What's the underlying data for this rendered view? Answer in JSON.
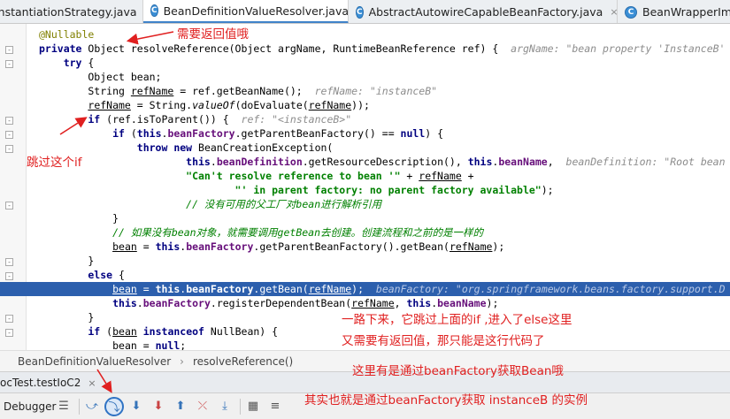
{
  "tabs": [
    {
      "label": "InstantiationStrategy.java",
      "active": false
    },
    {
      "label": "BeanDefinitionValueResolver.java",
      "active": true
    },
    {
      "label": "AbstractAutowireCapableBeanFactory.java",
      "active": false
    },
    {
      "label": "BeanWrapperImp",
      "active": false
    }
  ],
  "tab_close_glyph": "×",
  "code": {
    "l1": "@Nullable",
    "l2_a": "private ",
    "l2_b": "Object resolveReference(Object argName, RuntimeBeanReference ref) {",
    "l2_hint": "argName: \"bean property 'InstanceB'",
    "l3_a": "    try",
    "l3_b": " {",
    "l4": "        Object bean;",
    "l5_a": "        String ",
    "l5_b": "refName",
    "l5_c": " = ref.getBeanName();",
    "l5_hint": "refName: \"instanceB\"",
    "l6_a": "        ",
    "l6_b": "refName",
    "l6_c": " = String.",
    "l6_d": "valueOf",
    "l6_e": "(doEvaluate(",
    "l6_f": "refName",
    "l6_g": "));",
    "l7_a": "        if",
    "l7_b": " (ref.isToParent()) {",
    "l7_hint": "ref: \"<instanceB>\"",
    "l8_a": "            if",
    "l8_b": " (",
    "l8_c": "this",
    "l8_d": ".",
    "l8_e": "beanFactory",
    "l8_f": ".getParentBeanFactory() == ",
    "l8_g": "null",
    "l8_h": ") {",
    "l9_a": "                throw new",
    "l9_b": " BeanCreationException(",
    "l10_a": "                        this",
    "l10_b": ".",
    "l10_c": "beanDefinition",
    "l10_d": ".getResourceDescription(), ",
    "l10_e": "this",
    "l10_f": ".",
    "l10_g": "beanName",
    "l10_h": ",",
    "l10_hint": "beanDefinition: \"Root bean",
    "l11_a": "                        \"Can't resolve reference to bean '\"",
    "l11_b": " + ",
    "l11_c": "refName",
    "l11_d": " +",
    "l12_a": "                                \"' in parent factory: no parent factory available\"",
    "l12_b": ");",
    "l13": "                        // 没有可用的父工厂对bean进行解析引用",
    "l14": "            }",
    "l15": "            // 如果没有bean对象，就需要调用getBean去创建。创建流程和之前的是一样的",
    "l16_a": "            ",
    "l16_b": "bean",
    "l16_c": " = ",
    "l16_d": "this",
    "l16_e": ".",
    "l16_f": "beanFactory",
    "l16_g": ".getParentBeanFactory().getBean(",
    "l16_h": "refName",
    "l16_i": ");",
    "l17": "        }",
    "l18_a": "        else",
    "l18_b": " {",
    "l19_a": "            ",
    "l19_b": "bean",
    "l19_c": " = ",
    "l19_d": "this",
    "l19_e": ".",
    "l19_f": "beanFactory",
    "l19_g": ".getBean(",
    "l19_h": "refName",
    "l19_i": ");",
    "l19_hint": "beanFactory: \"org.springframework.beans.factory.support.D",
    "l20_a": "            ",
    "l20_b": "this",
    "l20_c": ".",
    "l20_d": "beanFactory",
    "l20_e": ".registerDependentBean(",
    "l20_f": "refName",
    "l20_g": ", ",
    "l20_h": "this",
    "l20_i": ".",
    "l20_j": "beanName",
    "l20_k": ");",
    "l21": "        }",
    "l22_a": "        if",
    "l22_b": " (",
    "l22_c": "bean",
    "l22_d": " ",
    "l22_e": "instanceof",
    "l22_f": " NullBean) {",
    "l23_a": "            ",
    "l23_b": "bean",
    "l23_c": " = ",
    "l23_d": "null",
    "l23_e": ";"
  },
  "breadcrumb": {
    "class_name": "BeanDefinitionValueResolver",
    "separator": "›",
    "method": "resolveReference()"
  },
  "run_tab": {
    "label": "ocTest.testIoC2"
  },
  "debugger": {
    "label": "Debugger",
    "tools": [
      {
        "name": "menu-icon",
        "glyph": "☰"
      },
      {
        "name": "show-execution-point-icon",
        "glyph": "⤻"
      },
      {
        "name": "step-over-icon",
        "glyph": "⤵"
      },
      {
        "name": "step-into-icon",
        "glyph": "⬇"
      },
      {
        "name": "force-step-into-icon",
        "glyph": "⬇"
      },
      {
        "name": "step-out-icon",
        "glyph": "⬆"
      },
      {
        "name": "drop-frame-icon",
        "glyph": "⤫"
      },
      {
        "name": "run-to-cursor-icon",
        "glyph": "⤓"
      },
      {
        "name": "evaluate-expression-icon",
        "glyph": "▦"
      },
      {
        "name": "trace-icon",
        "glyph": "≡"
      }
    ]
  },
  "annotations": {
    "needs_return": "需要返回值哦",
    "skip_if": "跳过这个if",
    "else_path": "一路下来，它跳过上面的if ,进入了else这里",
    "only_this_line": "又需要有返回值，那只能是这行代码了",
    "via_beanfactory": "这里有是通过beanFactory获取Bean哦",
    "get_instance": "其实也就是通过beanFactory获取 instanceB 的实例"
  },
  "colors": {
    "annotation": "#e02020",
    "execution_line": "#2c5fad",
    "keyword": "#000080",
    "string": "#008000",
    "field": "#660e7a",
    "annotation_tag": "#808000"
  }
}
